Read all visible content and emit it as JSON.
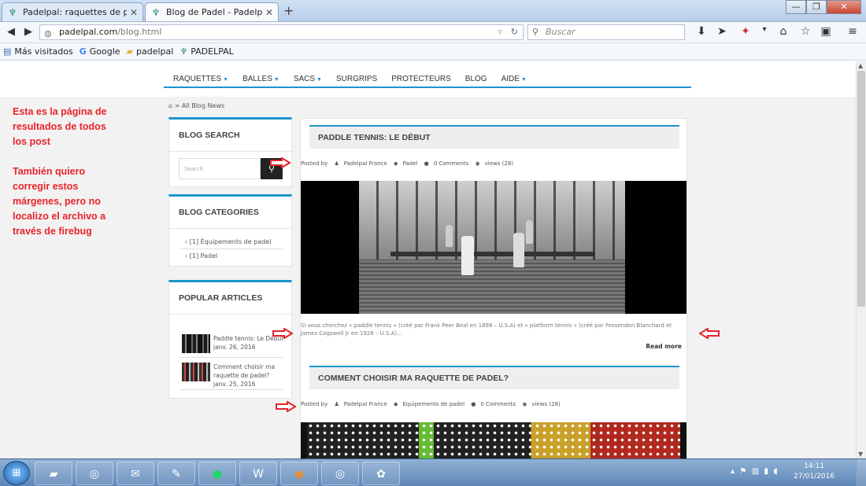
{
  "browser": {
    "tabs": [
      {
        "label": "Padelpal: raquettes de pad..."
      },
      {
        "label": "Blog de Padel - Padelpal.c..."
      }
    ],
    "new_tab": "+",
    "win_min": "—",
    "win_max": "❐",
    "win_close": "✕",
    "url_host": "padelpal.com",
    "url_path": "/blog.html",
    "search_placeholder": "Buscar",
    "bookmarks": [
      {
        "label": "Más visitados"
      },
      {
        "label": "Google"
      },
      {
        "label": "padelpal"
      },
      {
        "label": "PADELPAL"
      }
    ]
  },
  "site": {
    "menu": [
      {
        "label": "RAQUETTES",
        "caret": "▼"
      },
      {
        "label": "BALLES",
        "caret": "▼"
      },
      {
        "label": "SACS",
        "caret": "▼"
      },
      {
        "label": "SURGRIPS",
        "caret": ""
      },
      {
        "label": "PROTECTEURS",
        "caret": ""
      },
      {
        "label": "BLOG",
        "caret": ""
      },
      {
        "label": "AIDE",
        "caret": "▼"
      }
    ],
    "breadcrumb": "> All Blog News",
    "note_lines": [
      "Esta es la página de resultados de todos los post",
      "También quiero corregir estos márgenes, pero no localizo el archivo a través de firebug"
    ],
    "blog_search": {
      "title": "BLOG SEARCH",
      "placeholder": "Search"
    },
    "blog_categories": {
      "title": "BLOG CATEGORIES",
      "items": [
        "[1] Équipements de padel",
        "[1] Padel"
      ]
    },
    "popular": {
      "title": "POPULAR ARTICLES",
      "items": [
        {
          "title": "Paddle tennis: Le Début",
          "date": "janv. 26, 2016"
        },
        {
          "title": "Comment choisir ma raquette de padel?",
          "date": "janv. 25, 2016"
        }
      ]
    },
    "posts": [
      {
        "title": "PADDLE TENNIS: LE DÉBUT",
        "posted_by": "Posted by",
        "author": "Padelpal France",
        "category": "Padel",
        "comments": "0 Comments",
        "views": "views (28)",
        "excerpt": "Si vous cherchez « paddle tennis » (créé par Frank Peer Beal en 1898 – U.S.A) et « platform tennis » (créé par Fessenden Blanchard et James Cogswell Jr en 1928 – U.S.A)...",
        "read_more": "Read more"
      },
      {
        "title": "COMMENT CHOISIR MA RAQUETTE DE PADEL?",
        "posted_by": "Posted by",
        "author": "Padelpal France",
        "category": "Equipements de padel",
        "comments": "0 Comments",
        "views": "views (28)"
      }
    ]
  },
  "taskbar": {
    "time": "14:11",
    "date": "27/01/2016"
  },
  "colors": {
    "accent": "#1c95cc",
    "annotation": "#e8232b"
  }
}
